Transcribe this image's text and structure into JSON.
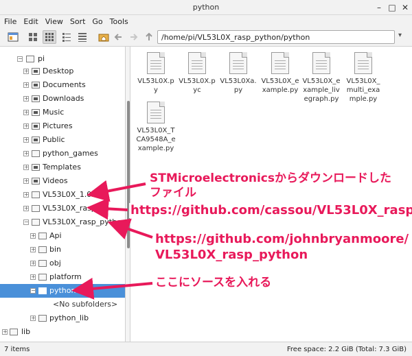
{
  "window": {
    "title": "python"
  },
  "menu": [
    "File",
    "Edit",
    "View",
    "Sort",
    "Go",
    "Tools"
  ],
  "path": {
    "value": "/home/pi/VL53L0X_rasp_python/python"
  },
  "tree": {
    "root": "pi",
    "items": [
      {
        "label": "Desktop",
        "icon": "desktop-folder-icon"
      },
      {
        "label": "Documents",
        "icon": "documents-folder-icon"
      },
      {
        "label": "Downloads",
        "icon": "downloads-folder-icon"
      },
      {
        "label": "Music",
        "icon": "music-folder-icon"
      },
      {
        "label": "Pictures",
        "icon": "pictures-folder-icon"
      },
      {
        "label": "Public",
        "icon": "public-folder-icon"
      },
      {
        "label": "python_games",
        "icon": "folder-icon"
      },
      {
        "label": "Templates",
        "icon": "templates-folder-icon"
      },
      {
        "label": "Videos",
        "icon": "videos-folder-icon"
      },
      {
        "label": "VL53L0X_1.0.2",
        "icon": "folder-icon"
      },
      {
        "label": "VL53L0X_rasp",
        "icon": "folder-icon"
      },
      {
        "label": "VL53L0X_rasp_python",
        "icon": "folder-icon"
      }
    ],
    "sub": [
      {
        "label": "Api"
      },
      {
        "label": "bin"
      },
      {
        "label": "obj"
      },
      {
        "label": "platform"
      },
      {
        "label": "python"
      },
      {
        "label": "<No subfolders>"
      },
      {
        "label": "python_lib"
      }
    ],
    "bottom": [
      {
        "label": "lib"
      }
    ]
  },
  "files": [
    {
      "name": "VL53L0X.py"
    },
    {
      "name": "VL53L0X.pyc"
    },
    {
      "name": "VL53L0Xa.py"
    },
    {
      "name": "VL53L0X_example.py"
    },
    {
      "name": "VL53L0X_example_livegraph.py"
    },
    {
      "name": "VL53L0X_multi_example.py"
    },
    {
      "name": "VL53L0X_TCA9548A_example.py"
    }
  ],
  "status": {
    "items": "7 items",
    "free": "Free space: 2.2 GiB (Total: 7.3 GiB)"
  },
  "annotations": {
    "st_line1": "STMicroelectronicsからダウンロードした",
    "st_line2": "ファイル",
    "cassou": "https://github.com/cassou/VL53L0X_rasp",
    "john_line1": "https://github.com/johnbryanmoore/",
    "john_line2": "VL53L0X_rasp_python",
    "here": "ここにソースを入れる"
  },
  "colors": {
    "annotation": "#e8195a",
    "selection": "#4a90d9"
  }
}
